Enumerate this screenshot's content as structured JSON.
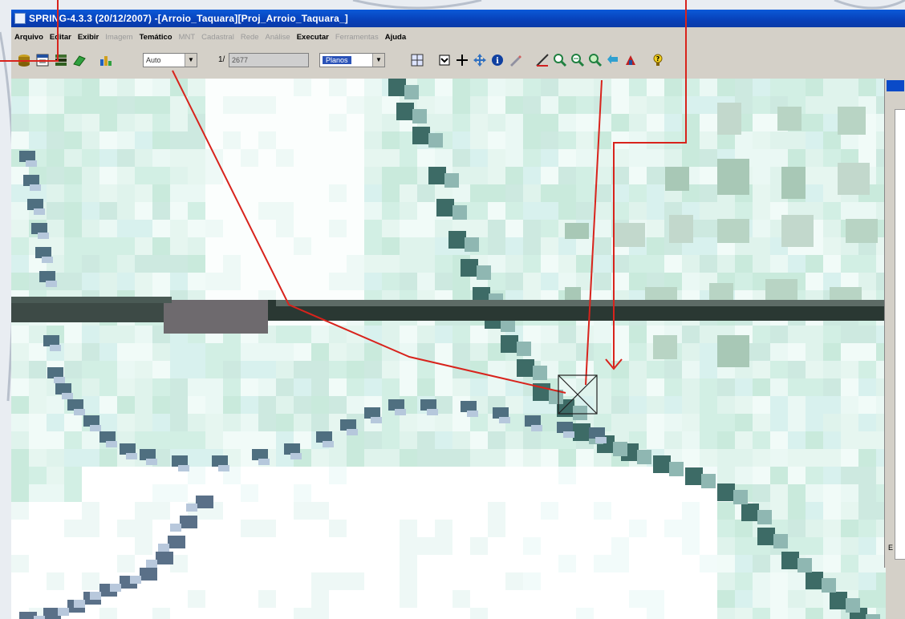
{
  "window": {
    "title": "SPRING-4.3.3 (20/12/2007) -[Arroio_Taquara][Proj_Arroio_Taquara_]"
  },
  "menu": [
    {
      "label": "Arquivo",
      "enabled": true
    },
    {
      "label": "Editar",
      "enabled": true
    },
    {
      "label": "Exibir",
      "enabled": true
    },
    {
      "label": "Imagem",
      "enabled": false
    },
    {
      "label": "Temático",
      "enabled": true
    },
    {
      "label": "MNT",
      "enabled": false
    },
    {
      "label": "Cadastral",
      "enabled": false
    },
    {
      "label": "Rede",
      "enabled": false
    },
    {
      "label": "Análise",
      "enabled": false
    },
    {
      "label": "Executar",
      "enabled": true
    },
    {
      "label": "Ferramentas",
      "enabled": false
    },
    {
      "label": "Ajuda",
      "enabled": true
    }
  ],
  "toolbar": {
    "mode_combo_value": "Auto",
    "scale_label": "1/",
    "scale_value": "2677",
    "plane_combo_value": "Planos"
  },
  "right_panel": {
    "bottom_label": "E"
  },
  "colors": {
    "titlebar": "#0a4ac8",
    "annotation_line": "#d8231c",
    "road": "#1f2f2a"
  }
}
